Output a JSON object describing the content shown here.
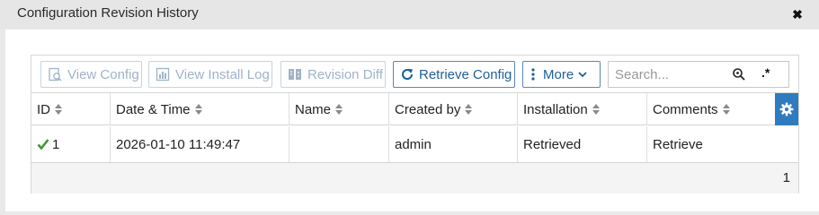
{
  "dialog": {
    "title": "Configuration Revision History",
    "close_glyph": "✖"
  },
  "toolbar": {
    "view_config": "View Config",
    "view_install_log": "View Install Log",
    "revision_diff": "Revision Diff",
    "retrieve_config": "Retrieve Config",
    "more": "More",
    "search_placeholder": "Search...",
    "regex_glyph": ".*"
  },
  "table": {
    "columns": [
      "ID",
      "Date & Time",
      "Name",
      "Created by",
      "Installation",
      "Comments"
    ],
    "rows": [
      {
        "id": "1",
        "date_time": "2026-01-10 11:49:47",
        "name": "",
        "created_by": "admin",
        "installation": "Retrieved",
        "comments": "Retrieve"
      }
    ],
    "total_count": "1"
  },
  "colors": {
    "accent": "#2e7bbf",
    "success": "#3c9a2e",
    "disabled_text": "#9fb3c8"
  }
}
